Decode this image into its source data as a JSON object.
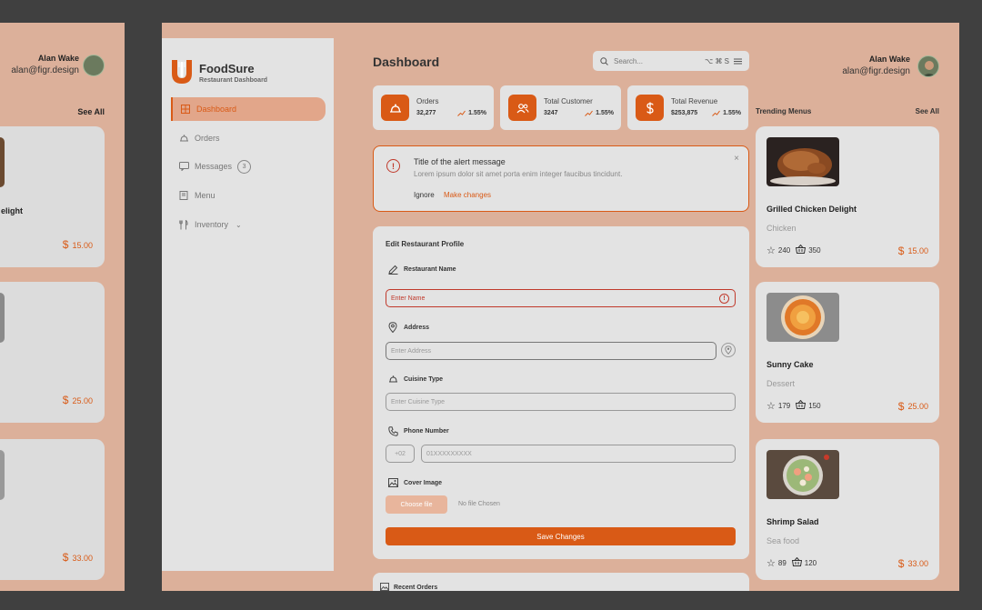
{
  "brand": {
    "name": "FoodSure",
    "subtitle": "Restaurant Dashboard"
  },
  "page": {
    "title": "Dashboard"
  },
  "search": {
    "placeholder": "Search...",
    "shortcut": "⌥ ⌘ S"
  },
  "user": {
    "name": "Alan Wake",
    "email": "alan@figr.design"
  },
  "nav": [
    {
      "label": "Dashboard",
      "icon": "grid-icon",
      "active": true
    },
    {
      "label": "Orders",
      "icon": "cloche-icon"
    },
    {
      "label": "Messages",
      "icon": "chat-icon",
      "badge": "3"
    },
    {
      "label": "Menu",
      "icon": "book-icon"
    },
    {
      "label": "Inventory",
      "icon": "utensils-icon"
    }
  ],
  "stats": [
    {
      "label": "Orders",
      "value": "32,277",
      "trend": "1.55%",
      "icon": "cloche-icon"
    },
    {
      "label": "Total Customer",
      "value": "3247",
      "trend": "1.55%",
      "icon": "users-icon"
    },
    {
      "label": "Total Revenue",
      "value": "$253,875",
      "trend": "1.55%",
      "icon": "dollar-icon"
    }
  ],
  "alert": {
    "title": "Title of the alert message",
    "body": "Lorem ipsum dolor sit amet porta enim integer faucibus tincidunt.",
    "ignore": "Ignore",
    "action": "Make changes"
  },
  "form": {
    "title": "Edit Restaurant Profile",
    "name_label": "Restaurant Name",
    "name_placeholder": "Enter Name",
    "address_label": "Address",
    "address_placeholder": "Enter Address",
    "cuisine_label": "Cuisine Type",
    "cuisine_placeholder": "Enter Cuisine Type",
    "phone_label": "Phone Number",
    "phone_code": "+02",
    "phone_placeholder": "01XXXXXXXXX",
    "cover_label": "Cover Image",
    "choose_file": "Choose file",
    "no_file": "No file Chosen",
    "save": "Save Changes"
  },
  "recent": {
    "title": "Recent Orders"
  },
  "trending": {
    "title": "Trending Menus",
    "see_all": "See All",
    "items": [
      {
        "name": "Grilled Chicken Delight",
        "category": "Chicken",
        "rating": "240",
        "orders": "350",
        "price": "15.00"
      },
      {
        "name": "Sunny Cake",
        "category": "Dessert",
        "rating": "179",
        "orders": "150",
        "price": "25.00"
      },
      {
        "name": "Shrimp Salad",
        "category": "Sea food",
        "rating": "89",
        "orders": "120",
        "price": "33.00"
      }
    ]
  },
  "ghost": {
    "name": "Alan Wake",
    "email": "alan@figr.design",
    "see_all": "See All",
    "item_title": "elight",
    "prices": [
      "15.00",
      "25.00",
      "33.00"
    ]
  },
  "colors": {
    "accent": "#d95a16",
    "frame": "#dcb09a",
    "panel": "#e3e3e3",
    "error": "#c0392b"
  }
}
